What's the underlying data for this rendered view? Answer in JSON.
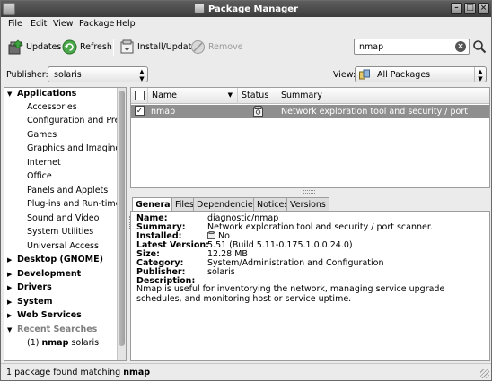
{
  "window": {
    "title": "Package Manager"
  },
  "menu": [
    "File",
    "Edit",
    "View",
    "Package",
    "Help"
  ],
  "toolbar": {
    "updates": "Updates",
    "refresh": "Refresh",
    "install_update": "Install/Update",
    "remove": "Remove",
    "search_value": "nmap"
  },
  "filters": {
    "publisher_label": "Publisher:",
    "publisher_value": "solaris",
    "view_label": "View:",
    "view_value": "All Packages"
  },
  "tree": {
    "categories": [
      {
        "label": "Applications",
        "expanded": true
      },
      {
        "label": "Desktop (GNOME)",
        "expanded": false
      },
      {
        "label": "Development",
        "expanded": false
      },
      {
        "label": "Drivers",
        "expanded": false
      },
      {
        "label": "System",
        "expanded": false
      },
      {
        "label": "Web Services",
        "expanded": false
      },
      {
        "label": "Recent Searches",
        "expanded": true
      }
    ],
    "applications": [
      "Accessories",
      "Configuration and Prefer",
      "Games",
      "Graphics and Imaging",
      "Internet",
      "Office",
      "Panels and Applets",
      "Plug-ins and Run-times",
      "Sound and Video",
      "System Utilities",
      "Universal Access"
    ],
    "recent": {
      "count": "(1)",
      "name": "nmap",
      "publisher": "solaris"
    }
  },
  "package_list": {
    "columns": [
      "Name",
      "Status",
      "Summary"
    ],
    "rows": [
      {
        "name": "nmap",
        "summary": "Network exploration tool and security / port scanner."
      }
    ]
  },
  "details": {
    "tabs": [
      "General",
      "Files",
      "Dependencies",
      "Notices",
      "Versions"
    ],
    "fields": [
      {
        "key": "Name:",
        "value": "diagnostic/nmap"
      },
      {
        "key": "Summary:",
        "value": "Network exploration tool and security / port scanner."
      },
      {
        "key": "Installed:",
        "value": "No"
      },
      {
        "key": "Latest Version:",
        "value": "5.51 (Build 5.11-0.175.1.0.0.24.0)"
      },
      {
        "key": "Size:",
        "value": "12.28 MB"
      },
      {
        "key": "Category:",
        "value": "System/Administration and Configuration"
      },
      {
        "key": "Publisher:",
        "value": "solaris"
      },
      {
        "key": "Description:",
        "value": ""
      }
    ],
    "description": "Nmap is useful for inventorying the network, managing service upgrade schedules, and monitoring host or service uptime."
  },
  "status": {
    "prefix": "1 package found matching",
    "term": "nmap"
  },
  "icons": [
    "window-menu-icon",
    "updates-icon",
    "refresh-icon",
    "install-icon",
    "remove-icon",
    "clear-search-icon",
    "search-icon",
    "publisher-icon",
    "view-icon",
    "status-not-installed-icon"
  ]
}
